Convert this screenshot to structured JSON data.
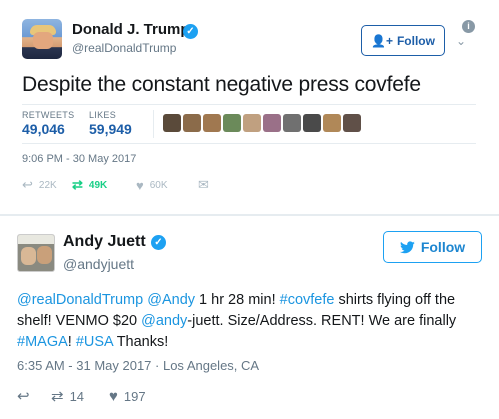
{
  "tweet1": {
    "author_name": "Donald J. Trump",
    "handle": "@realDonaldTrump",
    "follow_label": "Follow",
    "text": "Despite the constant negative press covfefe",
    "stats": {
      "retweets_label": "RETWEETS",
      "retweets_value": "49,046",
      "likes_label": "LIKES",
      "likes_value": "59,949"
    },
    "liker_avatars": [
      "#5a4a3a",
      "#8b6b4a",
      "#a07850",
      "#6b8a5a",
      "#c0a080",
      "#9a7088",
      "#707070",
      "#4a4a4a",
      "#b08858",
      "#605048"
    ],
    "timestamp": "9:06 PM - 30 May 2017",
    "actions": {
      "replies": "22K",
      "retweets": "49K",
      "likes": "60K"
    }
  },
  "tweet2": {
    "author_name": "Andy Juett",
    "handle": "@andyjuett",
    "follow_label": "Follow",
    "text_parts": [
      {
        "t": "@realDonaldTrump",
        "link": true
      },
      {
        "t": " ",
        "link": false
      },
      {
        "t": "@Andy",
        "link": true
      },
      {
        "t": " 1 hr 28 min! ",
        "link": false
      },
      {
        "t": "#covfefe",
        "link": true
      },
      {
        "t": " shirts flying off the shelf! VENMO $20 ",
        "link": false
      },
      {
        "t": "@andy",
        "link": true
      },
      {
        "t": "-juett. Size/Address. RENT! We are finally ",
        "link": false
      },
      {
        "t": "#MAGA",
        "link": true
      },
      {
        "t": "! ",
        "link": false
      },
      {
        "t": "#USA",
        "link": true
      },
      {
        "t": " Thanks!",
        "link": false
      }
    ],
    "timestamp": "6:35 AM - 31 May 2017 · Los Angeles, CA",
    "actions": {
      "retweets": "14",
      "likes": "197"
    }
  },
  "colors": {
    "link_blue": "#1b95e0",
    "verified_blue": "#1da1f2",
    "retweet_green": "#19cf86",
    "muted_gray": "#657786"
  }
}
